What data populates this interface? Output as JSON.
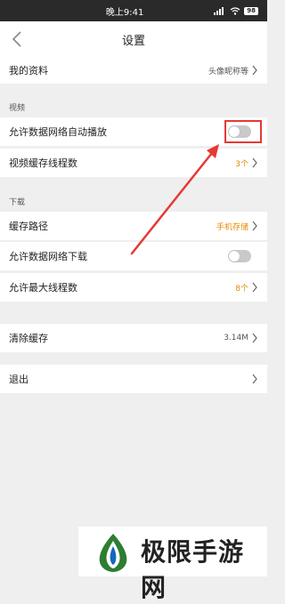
{
  "status_bar": {
    "time": "晚上9:41",
    "battery": "98"
  },
  "nav": {
    "title": "设置"
  },
  "profile": {
    "label": "我的资料",
    "value": "头像昵称等"
  },
  "video_section": {
    "header": "视频",
    "autoplay": {
      "label": "允许数据网络自动播放",
      "enabled": false
    },
    "cache_threads": {
      "label": "视频缓存线程数",
      "value": "3个"
    }
  },
  "download_section": {
    "header": "下载",
    "cache_path": {
      "label": "缓存路径",
      "value": "手机存储"
    },
    "mobile_download": {
      "label": "允许数据网络下载",
      "enabled": false
    },
    "max_threads": {
      "label": "允许最大线程数",
      "value": "8个"
    }
  },
  "clear_cache": {
    "label": "清除缓存",
    "value": "3.14M"
  },
  "logout": {
    "label": "退出"
  },
  "watermark": {
    "text": "极限手游网"
  },
  "colors": {
    "accent": "#e58a00",
    "annotation": "#e53935",
    "toggle_off": "#c9c9c9"
  }
}
